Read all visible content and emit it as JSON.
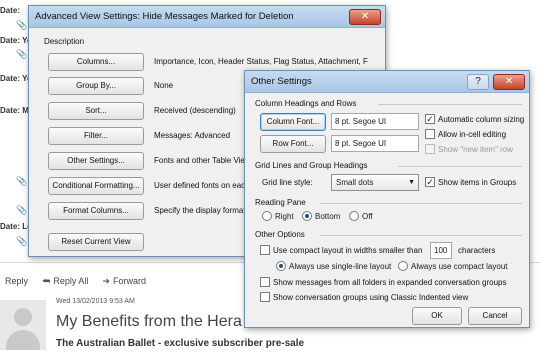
{
  "background": {
    "date_labels": [
      "Date:",
      "Date: Ye",
      "Date: Ye",
      "Date: M",
      "Date: Le"
    ],
    "attachment_glyph": "📎",
    "actions": [
      {
        "icon": "reply-icon",
        "label": "Reply"
      },
      {
        "icon": "reply-all-icon",
        "label": "Reply All"
      },
      {
        "icon": "forward-icon",
        "label": "Forward"
      }
    ],
    "message": {
      "date": "Wed 13/02/2013 9:53 AM",
      "subject": "My Benefits from the Hera",
      "from_line": "The Australian Ballet - exclusive subscriber pre-sale"
    }
  },
  "advanced_dialog": {
    "title": "Advanced View Settings: Hide Messages Marked for Deletion",
    "description_label": "Description",
    "rows": [
      {
        "button": "Columns...",
        "value": "Importance, Icon, Header Status, Flag Status, Attachment, F"
      },
      {
        "button": "Group By...",
        "value": "None"
      },
      {
        "button": "Sort...",
        "value": "Received (descending)"
      },
      {
        "button": "Filter...",
        "value": "Messages: Advanced"
      },
      {
        "button": "Other Settings...",
        "value": "Fonts and other Table Vie"
      },
      {
        "button": "Conditional Formatting...",
        "value": "User defined fonts on eac"
      },
      {
        "button": "Format Columns...",
        "value": "Specify the display format"
      }
    ],
    "reset_button": "Reset Current View"
  },
  "other_settings": {
    "title": "Other Settings",
    "close_glyph": "✕",
    "help_glyph": "?",
    "column_headings_label": "Column Headings and Rows",
    "column_font_button": "Column Font...",
    "column_font_value": "8 pt. Segoe UI",
    "row_font_button": "Row Font...",
    "row_font_value": "8 pt. Segoe UI",
    "auto_column_sizing": {
      "label": "Automatic column sizing",
      "checked": true
    },
    "allow_incell": {
      "label": "Allow in-cell editing",
      "checked": false
    },
    "show_new_item": {
      "label": "Show \"new item\" row",
      "checked": false
    },
    "grid_label": "Grid Lines and Group Headings",
    "grid_style_label": "Grid line style:",
    "grid_style_value": "Small dots",
    "show_items_in_groups": {
      "label": "Show items in Groups",
      "checked": true
    },
    "reading_pane_label": "Reading Pane",
    "reading_pane_options": [
      {
        "label": "Right",
        "selected": false
      },
      {
        "label": "Bottom",
        "selected": true
      },
      {
        "label": "Off",
        "selected": false
      }
    ],
    "other_options_label": "Other Options",
    "compact_layout": {
      "label": "Use compact layout in widths smaller than",
      "checked": false
    },
    "compact_width_value": "100",
    "compact_width_unit": "characters",
    "layout_options": [
      {
        "label": "Always use single-line layout",
        "selected": true
      },
      {
        "label": "Always use compact layout",
        "selected": false
      }
    ],
    "show_messages_all_folders": {
      "label": "Show messages from all folders in expanded conversation groups",
      "checked": false
    },
    "show_classic_indented": {
      "label": "Show conversation groups using Classic Indented view",
      "checked": false
    },
    "ok_button": "OK",
    "cancel_button": "Cancel"
  }
}
